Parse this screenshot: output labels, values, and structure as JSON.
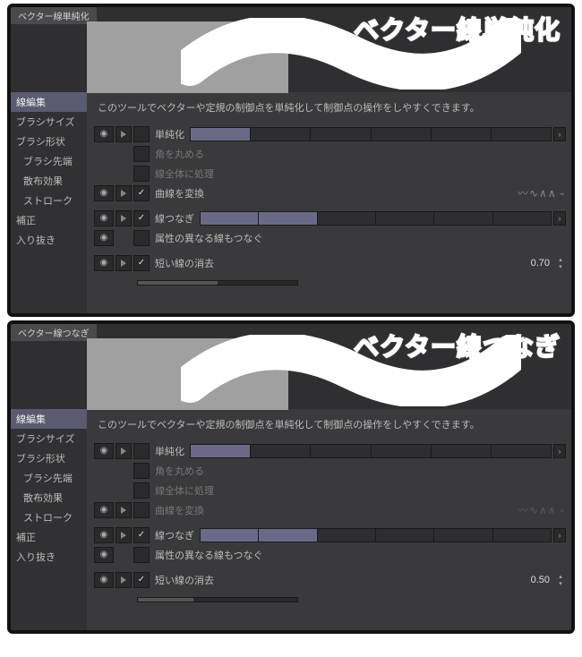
{
  "panels": [
    {
      "headline": "ベクター線単純化",
      "preview_title": "ベクター線単純化",
      "curve_convert_checked": true,
      "short_line_value": "0.70",
      "slider_simplify_fill": 1,
      "slider_connect_fill": 2
    },
    {
      "headline": "ベクター線つなぎ",
      "preview_title": "ベクター線つなぎ",
      "curve_convert_checked": false,
      "short_line_value": "0.50",
      "slider_simplify_fill": 1,
      "slider_connect_fill": 2
    }
  ],
  "sidebar": {
    "active": "線編集",
    "items": [
      "ブラシサイズ",
      "ブラシ形状",
      "ブラシ先端",
      "散布効果",
      "ストローク",
      "補正",
      "入り抜き"
    ],
    "indent_indices": [
      2,
      3,
      4
    ]
  },
  "description": "このツールでベクターや定規の制御点を単純化して制御点の操作をしやすくできます。",
  "options": {
    "simplify": "単純化",
    "round_corner": "角を丸める",
    "whole_line": "線全体に処理",
    "convert_curve": "曲線を変換",
    "connect": "線つなぎ",
    "connect_diff_attr": "属性の異なる線もつなぐ",
    "erase_short": "短い線の消去"
  }
}
